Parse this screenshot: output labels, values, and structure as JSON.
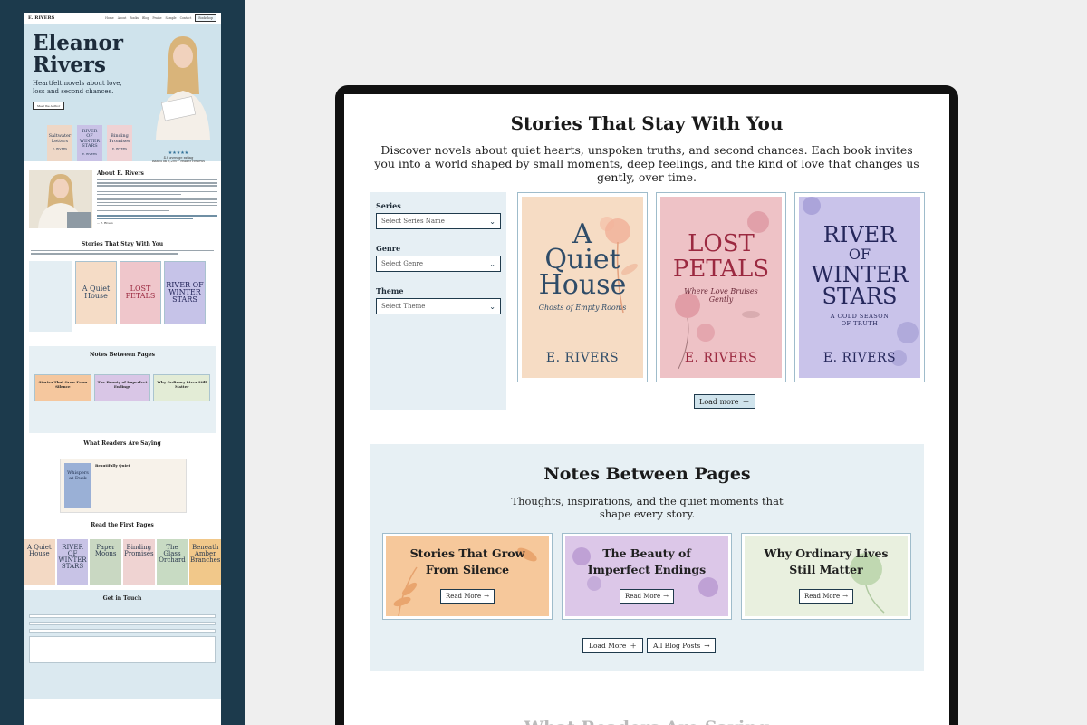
{
  "thumbnail": {
    "logo": "E. RIVERS",
    "nav": [
      "Home",
      "About",
      "Books",
      "Blog",
      "Praise",
      "Sample",
      "Contact"
    ],
    "nav_button": "Bookshop",
    "hero": {
      "name_line1": "Eleanor",
      "name_line2": "Rivers",
      "tagline": "Heartfelt novels about love, loss and second chances.",
      "button": "Meet the Author",
      "books": [
        {
          "title": "Saltwater Letters",
          "author": "E. RIVERS",
          "color": "#eed7c6"
        },
        {
          "title": "RIVER OF WINTER STARS",
          "author": "E. RIVERS",
          "color": "#c9c2e6"
        },
        {
          "title": "Binding Promises",
          "author": "E. RIVERS",
          "color": "#efd2d4"
        }
      ],
      "stars": "★★★★★",
      "rating": "4.8 average rating",
      "rating_sub": "Based on 3,200+ reader reviews"
    },
    "about": {
      "title": "About E. Rivers",
      "signature": "— E. Rivers"
    },
    "stories_title": "Stories That Stay With You",
    "mini_covers": [
      {
        "title": "A Quiet House",
        "color": "#f5dcc6"
      },
      {
        "title": "LOST PETALS",
        "color": "#efc6cb"
      },
      {
        "title": "RIVER OF WINTER STARS",
        "color": "#c6c3e8"
      }
    ],
    "notes_title": "Notes Between Pages",
    "notes_cards": [
      {
        "title": "Stories That Grow From Silence",
        "color": "#f5c79e"
      },
      {
        "title": "The Beauty of Imperfect Endings",
        "color": "#d9c6e6"
      },
      {
        "title": "Why Ordinary Lives Still Matter",
        "color": "#e3ecd6"
      }
    ],
    "reviews_title": "What Readers Are Saying",
    "review_book": "Whispers at Dusk",
    "review_heading": "Beautifully Quiet",
    "first_pages_title": "Read the First Pages",
    "first_pages": [
      {
        "title": "A Quiet House",
        "color": "#f3d9c4"
      },
      {
        "title": "RIVER OF WINTER STARS",
        "color": "#c8c3e6"
      },
      {
        "title": "Paper Moons",
        "color": "#c9d8c2"
      },
      {
        "title": "Binding Promises",
        "color": "#efd3d2"
      },
      {
        "title": "The Glass Orchard",
        "color": "#c8dbc3"
      },
      {
        "title": "Beneath Amber Branches",
        "color": "#f1c88a"
      }
    ],
    "contact_title": "Get in Touch"
  },
  "main": {
    "title": "Stories That Stay With You",
    "description": "Discover novels about quiet hearts, unspoken truths, and second chances. Each book invites you into a world shaped by small moments, deep feelings, and the kind of love that changes us gently, over time.",
    "filters": [
      {
        "label": "Series",
        "placeholder": "Select Series Name"
      },
      {
        "label": "Genre",
        "placeholder": "Select Genre"
      },
      {
        "label": "Theme",
        "placeholder": "Select Theme"
      }
    ],
    "books": [
      {
        "title_line1": "A",
        "title_line2": "Quiet",
        "title_line3": "House",
        "subtitle": "Ghosts of Empty Rooms",
        "author": "E. RIVERS",
        "bg": "#f6dcc4",
        "ink": "#2f4c68"
      },
      {
        "title_line1": "LOST",
        "title_line2": "PETALS",
        "title_line3": "",
        "subtitle": "Where Love Bruises Gently",
        "author": "E. RIVERS",
        "bg": "#eec2c6",
        "ink": "#9b2940"
      },
      {
        "title_line1": "RIVER",
        "title_line2": "OF",
        "title_line3": "WINTER STARS",
        "subtitle": "A COLD SEASON OF TRUTH",
        "author": "E. RIVERS",
        "bg": "#c9c3ea",
        "ink": "#25275b"
      }
    ],
    "load_more": "Load more",
    "notes": {
      "title": "Notes Between Pages",
      "description": "Thoughts, inspirations, and the quiet moments that shape every story.",
      "cards": [
        {
          "title": "Stories That Grow From Silence",
          "button": "Read More",
          "bg": "#f6c89b"
        },
        {
          "title": "The Beauty of Imperfect Endings",
          "button": "Read More",
          "bg": "#dcc7e8"
        },
        {
          "title": "Why Ordinary Lives Still Matter",
          "button": "Read More",
          "bg": "#e9f0df"
        }
      ],
      "load_more": "Load More",
      "all_posts": "All Blog Posts"
    },
    "next_section_title": "What Readers Are Saying"
  }
}
